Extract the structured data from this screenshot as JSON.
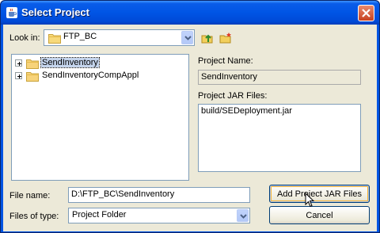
{
  "window": {
    "title": "Select Project"
  },
  "look_in": {
    "label": "Look in:",
    "value": "FTP_BC"
  },
  "toolbar": {
    "up_folder_icon": "up-folder-icon",
    "new_folder_icon": "new-folder-icon"
  },
  "tree": {
    "items": [
      {
        "label": "SendInventory",
        "selected": true
      },
      {
        "label": "SendInventoryCompAppl",
        "selected": false
      }
    ]
  },
  "project_name": {
    "label": "Project Name:",
    "value": "SendInventory"
  },
  "project_jar": {
    "label": "Project JAR Files:",
    "files": [
      "build/SEDeployment.jar"
    ]
  },
  "file_name": {
    "label": "File name:",
    "value": "D:\\FTP_BC\\SendInventory"
  },
  "files_of_type": {
    "label": "Files of type:",
    "value": "Project Folder"
  },
  "buttons": {
    "add_jar": "Add Project JAR Files",
    "cancel": "Cancel"
  },
  "colors": {
    "title_bar": "#0055e5",
    "dialog_bg": "#ece9d8",
    "selection": "#c4d4ec",
    "field_border": "#7f9db9"
  }
}
